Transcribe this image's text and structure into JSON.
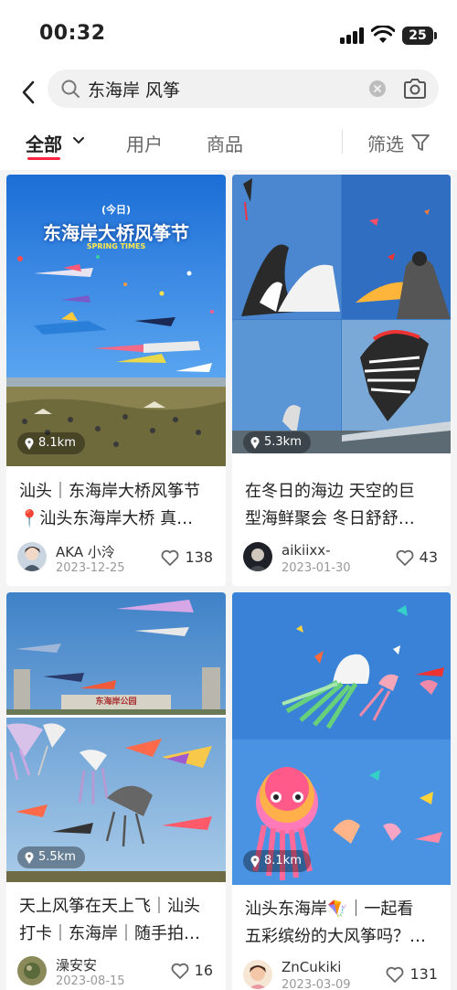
{
  "status_bar": {
    "time": "00:32",
    "battery": "25"
  },
  "search": {
    "query": "东海岸 风筝"
  },
  "tabs": {
    "all": "全部",
    "users": "用户",
    "goods": "商品",
    "filter": "筛选"
  },
  "cards": [
    {
      "overlay_title": "东海岸大桥风筝节",
      "overlay_tag": "(今日)",
      "overlay_sub": "SPRING TIMES",
      "distance": "8.1km",
      "title_line1": "汕头｜东海岸大桥风筝节",
      "title_line2": "📍汕头东海岸大桥 真…",
      "user": "AKA 小泠",
      "date": "2023-12-25",
      "likes": "138"
    },
    {
      "distance": "5.3km",
      "title_line1": "在冬日的海边 天空的巨",
      "title_line2": "型海鲜聚会 冬日舒舒…",
      "user": "aikiixx-",
      "date": "2023-01-30",
      "likes": "43"
    },
    {
      "overlay_sign": "东海岸公园",
      "distance": "5.5km",
      "title_line1": "天上风筝在天上飞｜汕头",
      "title_line2": "打卡｜东海岸｜随手拍…",
      "user": "澡安安",
      "date": "2023-08-15",
      "likes": "16"
    },
    {
      "distance": "8.1km",
      "title_line1": "汕头东海岸🪁｜一起看",
      "title_line2": "五彩缤纷的大风筝吗？…",
      "user": "ZnCukiki",
      "date": "2023-03-09",
      "likes": "131"
    }
  ]
}
